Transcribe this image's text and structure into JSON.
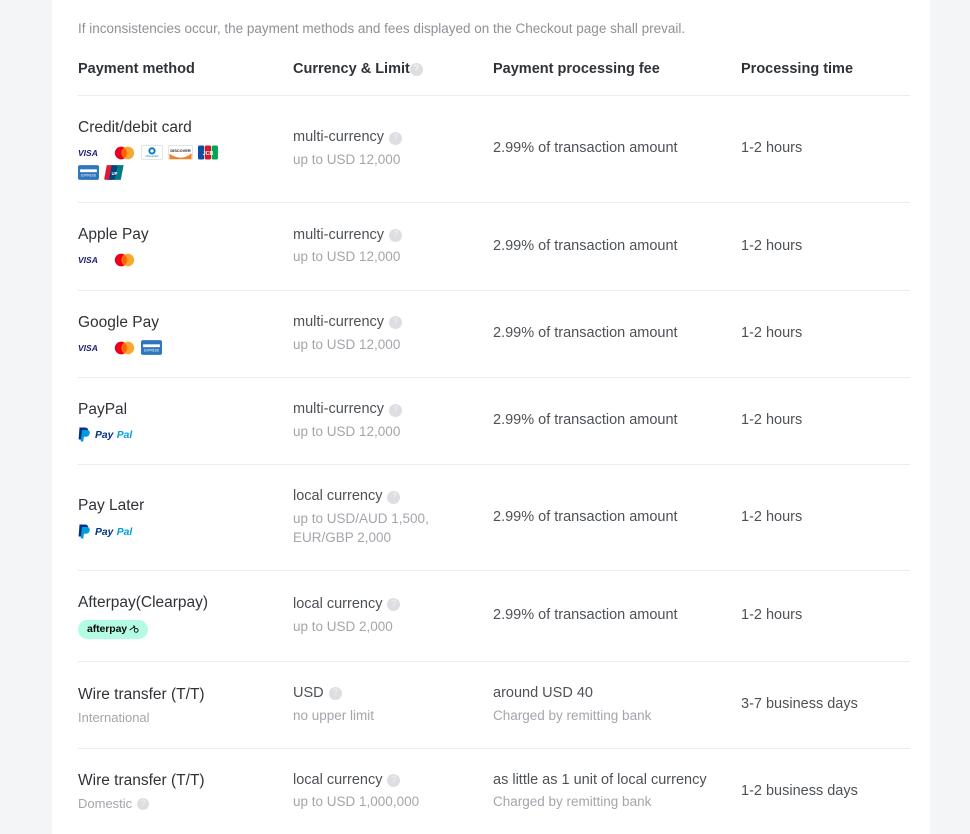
{
  "disclaimer": "If inconsistencies occur, the payment methods and fees displayed on the Checkout page shall prevail.",
  "columns": {
    "method": "Payment method",
    "currency": "Currency & Limit",
    "currency_has_info": true,
    "fee": "Payment processing fee",
    "time": "Processing time"
  },
  "colors": {
    "page_background": "#f4f5f7",
    "card_background": "#ffffff",
    "heading_text": "#2f3337",
    "body_text": "#4d5257",
    "muted_text": "#a2a6ab",
    "divider": "#ededf0",
    "info_icon": "#dcdee1",
    "afterpay_mint": "#b2fce4",
    "visa_blue": "#1a1f71",
    "mastercard_red": "#eb001b",
    "mastercard_yellow": "#f79e1b",
    "amex_blue": "#2e77bc",
    "discover_orange": "#f68121",
    "paypal_dark": "#003087",
    "paypal_light": "#009cde"
  },
  "rows": [
    {
      "method": "Credit/debit card",
      "sub": "",
      "sub_info": false,
      "logos": [
        "visa",
        "mastercard",
        "diners",
        "discover",
        "jcb",
        "amex",
        "unionpay"
      ],
      "currency": "multi-currency",
      "currency_info": true,
      "limit": "up to USD 12,000",
      "fee": "2.99% of transaction amount",
      "fee_sub": "",
      "time": "1-2 hours"
    },
    {
      "method": "Apple Pay",
      "sub": "",
      "sub_info": false,
      "logos": [
        "visa",
        "mastercard"
      ],
      "currency": "multi-currency",
      "currency_info": true,
      "limit": "up to USD 12,000",
      "fee": "2.99% of transaction amount",
      "fee_sub": "",
      "time": "1-2 hours"
    },
    {
      "method": "Google Pay",
      "sub": "",
      "sub_info": false,
      "logos": [
        "visa",
        "mastercard",
        "amex"
      ],
      "currency": "multi-currency",
      "currency_info": true,
      "limit": "up to USD 12,000",
      "fee": "2.99% of transaction amount",
      "fee_sub": "",
      "time": "1-2 hours"
    },
    {
      "method": "PayPal",
      "sub": "",
      "sub_info": false,
      "logos": [
        "paypal"
      ],
      "currency": "multi-currency",
      "currency_info": true,
      "limit": "up to USD 12,000",
      "fee": "2.99% of transaction amount",
      "fee_sub": "",
      "time": "1-2 hours"
    },
    {
      "method": "Pay Later",
      "sub": "",
      "sub_info": false,
      "logos": [
        "paypal"
      ],
      "currency": "local currency",
      "currency_info": true,
      "limit": "up to USD/AUD 1,500, EUR/GBP 2,000",
      "fee": "2.99% of transaction amount",
      "fee_sub": "",
      "time": "1-2 hours"
    },
    {
      "method": "Afterpay(Clearpay)",
      "sub": "",
      "sub_info": false,
      "logos": [
        "afterpay"
      ],
      "currency": "local currency",
      "currency_info": true,
      "limit": "up to USD 2,000",
      "fee": "2.99% of transaction amount",
      "fee_sub": "",
      "time": "1-2 hours"
    },
    {
      "method": "Wire transfer (T/T)",
      "sub": "International",
      "sub_info": false,
      "logos": [],
      "currency": "USD",
      "currency_info": true,
      "limit": "no upper limit",
      "fee": "around USD 40",
      "fee_sub": "Charged by remitting bank",
      "time": "3-7 business days"
    },
    {
      "method": "Wire transfer (T/T)",
      "sub": "Domestic",
      "sub_info": true,
      "logos": [],
      "currency": "local currency",
      "currency_info": true,
      "limit": "up to USD 1,000,000",
      "fee": "as little as 1 unit of local currency",
      "fee_sub": "Charged by remitting bank",
      "time": "1-2 business days"
    }
  ],
  "logo_labels": {
    "visa": "VISA",
    "mastercard": "Mastercard",
    "diners": "Diners Club",
    "discover": "DISCOVER",
    "jcb": "JCB",
    "amex": "American Express",
    "unionpay": "UnionPay",
    "paypal": "PayPal",
    "afterpay": "afterpay"
  }
}
